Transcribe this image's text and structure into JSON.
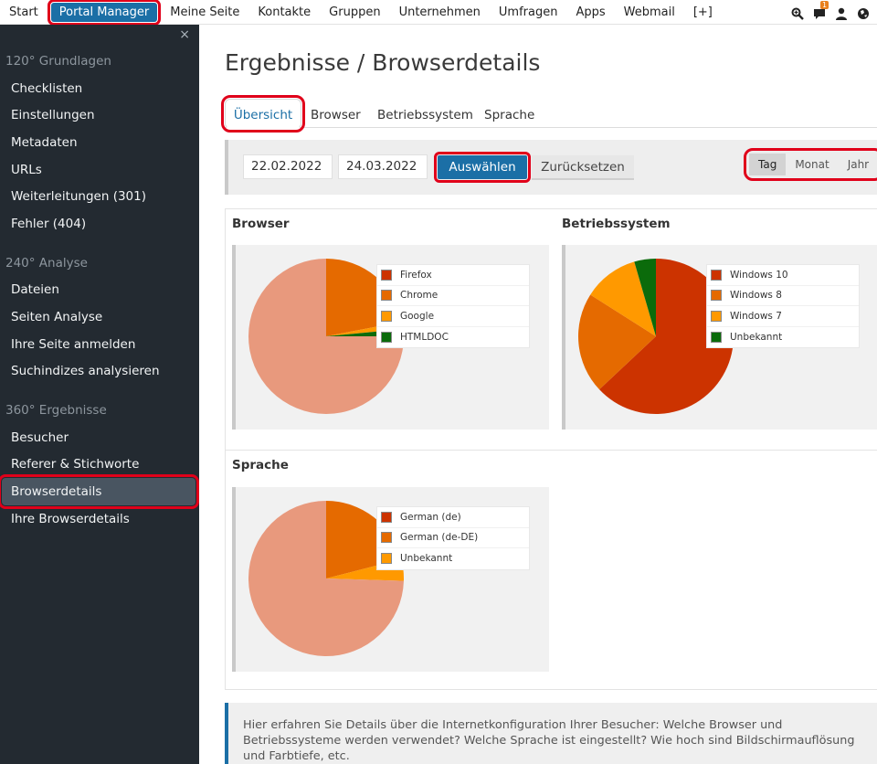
{
  "topnav": {
    "items": [
      {
        "label": "Start"
      },
      {
        "label": "Portal Manager",
        "active": true
      },
      {
        "label": "Meine Seite"
      },
      {
        "label": "Kontakte"
      },
      {
        "label": "Gruppen"
      },
      {
        "label": "Unternehmen"
      },
      {
        "label": "Umfragen"
      },
      {
        "label": "Apps"
      },
      {
        "label": "Webmail"
      },
      {
        "label": "[+]"
      }
    ],
    "notification_count": "1",
    "icons": [
      "search-zoom-icon",
      "chat-icon",
      "user-icon",
      "globe-icon"
    ]
  },
  "sidebar": {
    "close_label": "×",
    "sections": [
      {
        "title": "120° Grundlagen",
        "items": [
          "Checklisten",
          "Einstellungen",
          "Metadaten",
          "URLs",
          "Weiterleitungen (301)",
          "Fehler (404)"
        ]
      },
      {
        "title": "240° Analyse",
        "items": [
          "Dateien",
          "Seiten Analyse",
          "Ihre Seite anmelden",
          "Suchindizes analysieren"
        ]
      },
      {
        "title": "360° Ergebnisse",
        "items": [
          "Besucher",
          "Referer & Stichworte",
          "Browserdetails",
          "Ihre Browserdetails"
        ]
      }
    ],
    "active_item": "Browserdetails"
  },
  "main": {
    "title": "Ergebnisse / Browserdetails",
    "tabs": [
      "Übersicht",
      "Browser",
      "Betriebssystem",
      "Sprache"
    ],
    "filter": {
      "date_from": "22.02.2022",
      "date_to": "24.03.2022",
      "select_label": "Auswählen",
      "reset_label": "Zurücksetzen",
      "periods": [
        "Tag",
        "Monat",
        "Jahr"
      ],
      "active_period": "Tag"
    },
    "charts": [
      {
        "heading": "Browser"
      },
      {
        "heading": "Betriebssystem"
      },
      {
        "heading": "Sprache"
      }
    ],
    "info_text": "Hier erfahren Sie Details über die Internetkonfiguration Ihrer Besucher: Welche Browser und Betriebssysteme werden verwendet? Welche Sprache ist eingestellt? Wie hoch sind Bildschirmauflösung und Farbtiefe, etc."
  },
  "colors": {
    "accent": "#1b6fa6",
    "highlight": "#e0001a",
    "sidebar_bg": "#232a31"
  },
  "chart_data": [
    {
      "type": "pie",
      "title": "Browser",
      "series": [
        {
          "name": "Firefox",
          "value": 0.0,
          "color": "#cc3300"
        },
        {
          "name": "Chrome",
          "value": 22.0,
          "color": "#e56a00"
        },
        {
          "name": "Google",
          "value": 1.5,
          "color": "#ff9900"
        },
        {
          "name": "HTMLDOC",
          "value": 1.5,
          "color": "#0b6b0b"
        },
        {
          "name": "",
          "value": 75.0,
          "color": "#e8997d"
        }
      ]
    },
    {
      "type": "pie",
      "title": "Betriebssystem",
      "series": [
        {
          "name": "Windows 10",
          "value": 63.0,
          "color": "#cc3300"
        },
        {
          "name": "Windows 8",
          "value": 21.0,
          "color": "#e56a00"
        },
        {
          "name": "Windows 7",
          "value": 11.5,
          "color": "#ff9900"
        },
        {
          "name": "Unbekannt",
          "value": 4.5,
          "color": "#0b6b0b"
        }
      ]
    },
    {
      "type": "pie",
      "title": "Sprache",
      "series": [
        {
          "name": "German (de)",
          "value": 0.0,
          "color": "#cc3300"
        },
        {
          "name": "German (de-DE)",
          "value": 21.0,
          "color": "#e56a00"
        },
        {
          "name": "Unbekannt",
          "value": 4.5,
          "color": "#ff9900"
        },
        {
          "name": "",
          "value": 74.5,
          "color": "#e8997d"
        }
      ]
    }
  ]
}
